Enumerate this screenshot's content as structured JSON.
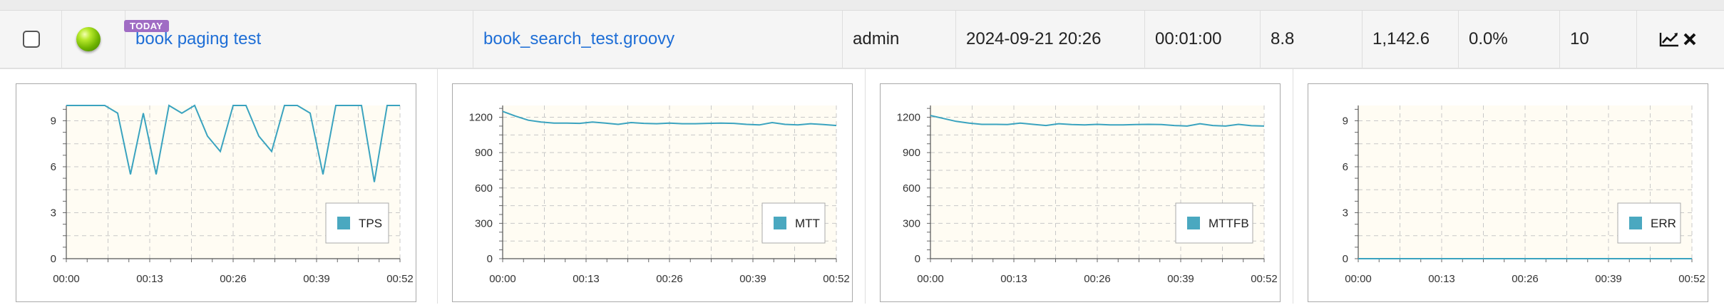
{
  "row": {
    "today_badge": "TODAY",
    "test_name": "book paging test",
    "script_name": "book_search_test.groovy",
    "owner": "admin",
    "start_time": "2024-09-21 20:26",
    "duration": "00:01:00",
    "tps": "8.8",
    "mean_test_time": "1,142.6",
    "error_rate": "0.0%",
    "vusers": "10",
    "actions": {
      "report_icon": "chart-line-icon",
      "delete_icon": "close-x-icon"
    },
    "status_color": "#7ac400"
  },
  "colors": {
    "line": "#3aa3bf",
    "legend_swatch": "#4aa8c0",
    "plot_bg": "#fffcf3",
    "link": "#1e6ed6",
    "badge": "#a06cc4"
  },
  "chart_data": [
    {
      "type": "line",
      "x_ticks": [
        "00:00",
        "00:13",
        "00:26",
        "00:39",
        "00:52"
      ],
      "xlim": [
        0,
        52
      ],
      "y_ticks": [
        "0",
        "3",
        "6",
        "9"
      ],
      "ylim": [
        0,
        10
      ],
      "grid": true,
      "legend_position": "bottom-right",
      "series": [
        {
          "name": "TPS",
          "x": [
            0,
            2,
            4,
            6,
            8,
            10,
            12,
            14,
            16,
            18,
            20,
            22,
            24,
            26,
            28,
            30,
            32,
            34,
            36,
            38,
            40,
            42,
            44,
            46,
            48,
            50,
            52
          ],
          "y": [
            10,
            10,
            10,
            10,
            9.5,
            5.5,
            9.5,
            5.5,
            10,
            9.5,
            10,
            8,
            7,
            10,
            10,
            8,
            7,
            10,
            10,
            9.5,
            5.5,
            10,
            10,
            10,
            5,
            10,
            10
          ]
        }
      ]
    },
    {
      "type": "line",
      "x_ticks": [
        "00:00",
        "00:13",
        "00:26",
        "00:39",
        "00:52"
      ],
      "xlim": [
        0,
        52
      ],
      "y_ticks": [
        "0",
        "300",
        "600",
        "900",
        "1200"
      ],
      "ylim": [
        0,
        1300
      ],
      "grid": true,
      "legend_position": "bottom-right",
      "series": [
        {
          "name": "MTT",
          "x": [
            0,
            2,
            4,
            6,
            8,
            10,
            12,
            14,
            16,
            18,
            20,
            22,
            24,
            26,
            28,
            30,
            32,
            34,
            36,
            38,
            40,
            42,
            44,
            46,
            48,
            50,
            52
          ],
          "y": [
            1250,
            1210,
            1175,
            1160,
            1150,
            1150,
            1148,
            1160,
            1150,
            1140,
            1155,
            1148,
            1145,
            1150,
            1145,
            1145,
            1148,
            1150,
            1148,
            1140,
            1135,
            1155,
            1140,
            1135,
            1145,
            1138,
            1130
          ]
        }
      ]
    },
    {
      "type": "line",
      "x_ticks": [
        "00:00",
        "00:13",
        "00:26",
        "00:39",
        "00:52"
      ],
      "xlim": [
        0,
        52
      ],
      "y_ticks": [
        "0",
        "300",
        "600",
        "900",
        "1200"
      ],
      "ylim": [
        0,
        1300
      ],
      "grid": true,
      "legend_position": "bottom-right",
      "series": [
        {
          "name": "MTTFB",
          "x": [
            0,
            2,
            4,
            6,
            8,
            10,
            12,
            14,
            16,
            18,
            20,
            22,
            24,
            26,
            28,
            30,
            32,
            34,
            36,
            38,
            40,
            42,
            44,
            46,
            48,
            50,
            52
          ],
          "y": [
            1215,
            1190,
            1165,
            1150,
            1140,
            1140,
            1138,
            1150,
            1140,
            1130,
            1145,
            1138,
            1135,
            1140,
            1135,
            1135,
            1138,
            1140,
            1138,
            1130,
            1125,
            1145,
            1130,
            1125,
            1140,
            1128,
            1125
          ]
        }
      ]
    },
    {
      "type": "line",
      "x_ticks": [
        "00:00",
        "00:13",
        "00:26",
        "00:39",
        "00:52"
      ],
      "xlim": [
        0,
        52
      ],
      "y_ticks": [
        "0",
        "3",
        "6",
        "9"
      ],
      "ylim": [
        0,
        10
      ],
      "grid": true,
      "legend_position": "bottom-right",
      "series": [
        {
          "name": "ERR",
          "x": [
            0,
            52
          ],
          "y": [
            0,
            0
          ]
        }
      ]
    }
  ]
}
